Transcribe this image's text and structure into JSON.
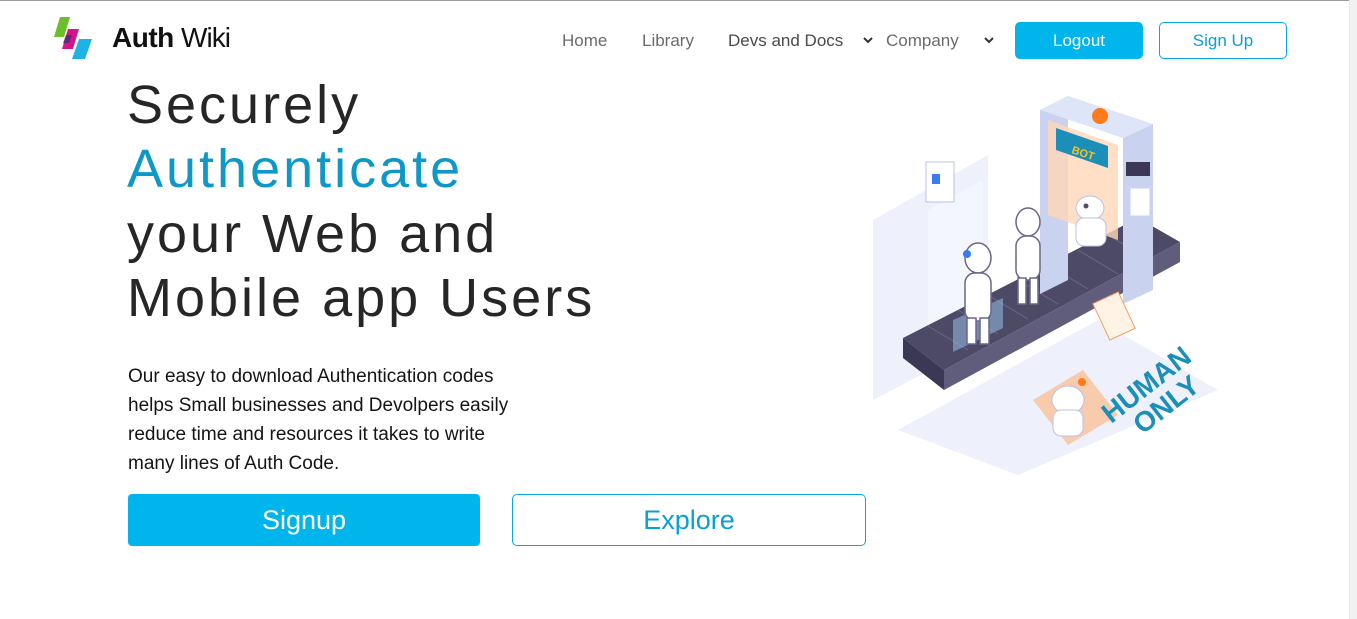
{
  "header": {
    "brand_bold": "Auth",
    "brand_light": "Wiki",
    "nav": [
      {
        "label": "Home"
      },
      {
        "label": "Library"
      },
      {
        "label": "Devs and Docs"
      },
      {
        "label": "Company"
      }
    ],
    "logout_label": "Logout",
    "signup_label": "Sign Up"
  },
  "hero": {
    "lines": [
      "Securely",
      "Authenticate",
      "your Web and",
      "Mobile app Users"
    ],
    "description_lines": [
      "Our easy to download Authentication codes",
      "helps Small businesses and Devolpers easily",
      "reduce time and resources it takes to write",
      "many lines of Auth Code."
    ],
    "signup_label": "Signup",
    "explore_label": "Explore"
  },
  "illustration": {
    "gate_sign": "BOT",
    "floor_text_1": "HUMAN",
    "floor_text_2": "ONLY"
  },
  "colors": {
    "accent": "#00b4ec",
    "heading_accent": "#0d98c8",
    "logo_green": "#6bbf2a",
    "logo_magenta": "#d4148c",
    "logo_cyan": "#1fb2e6"
  }
}
